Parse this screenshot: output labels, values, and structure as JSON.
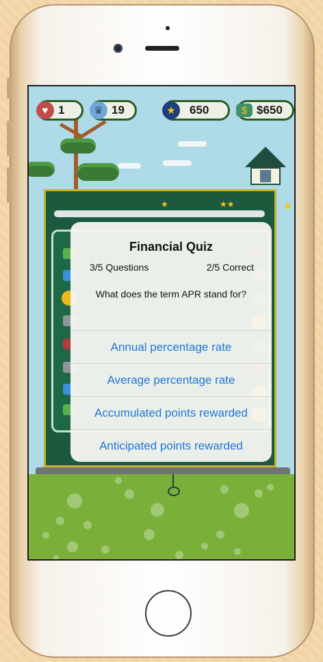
{
  "hud": {
    "lives": "1",
    "trophies": "19",
    "stars": "650",
    "money": "$650"
  },
  "quiz": {
    "title": "Financial Quiz",
    "progress": "3/5 Questions",
    "score": "2/5 Correct",
    "question": "What does the term APR stand for?",
    "answers": [
      "Annual percentage rate",
      "Average percentage rate",
      "Accumulated points rewarded",
      "Anticipated points rewarded"
    ]
  },
  "icons": {
    "lives": "heart-icon",
    "trophies": "trophy-icon",
    "stars": "star-icon",
    "money": "cash-icon"
  },
  "colors": {
    "answer_text": "#1e77d6",
    "hud_border": "#2a5a24",
    "board": "#1c5a3e",
    "ground": "#7ab03a"
  }
}
